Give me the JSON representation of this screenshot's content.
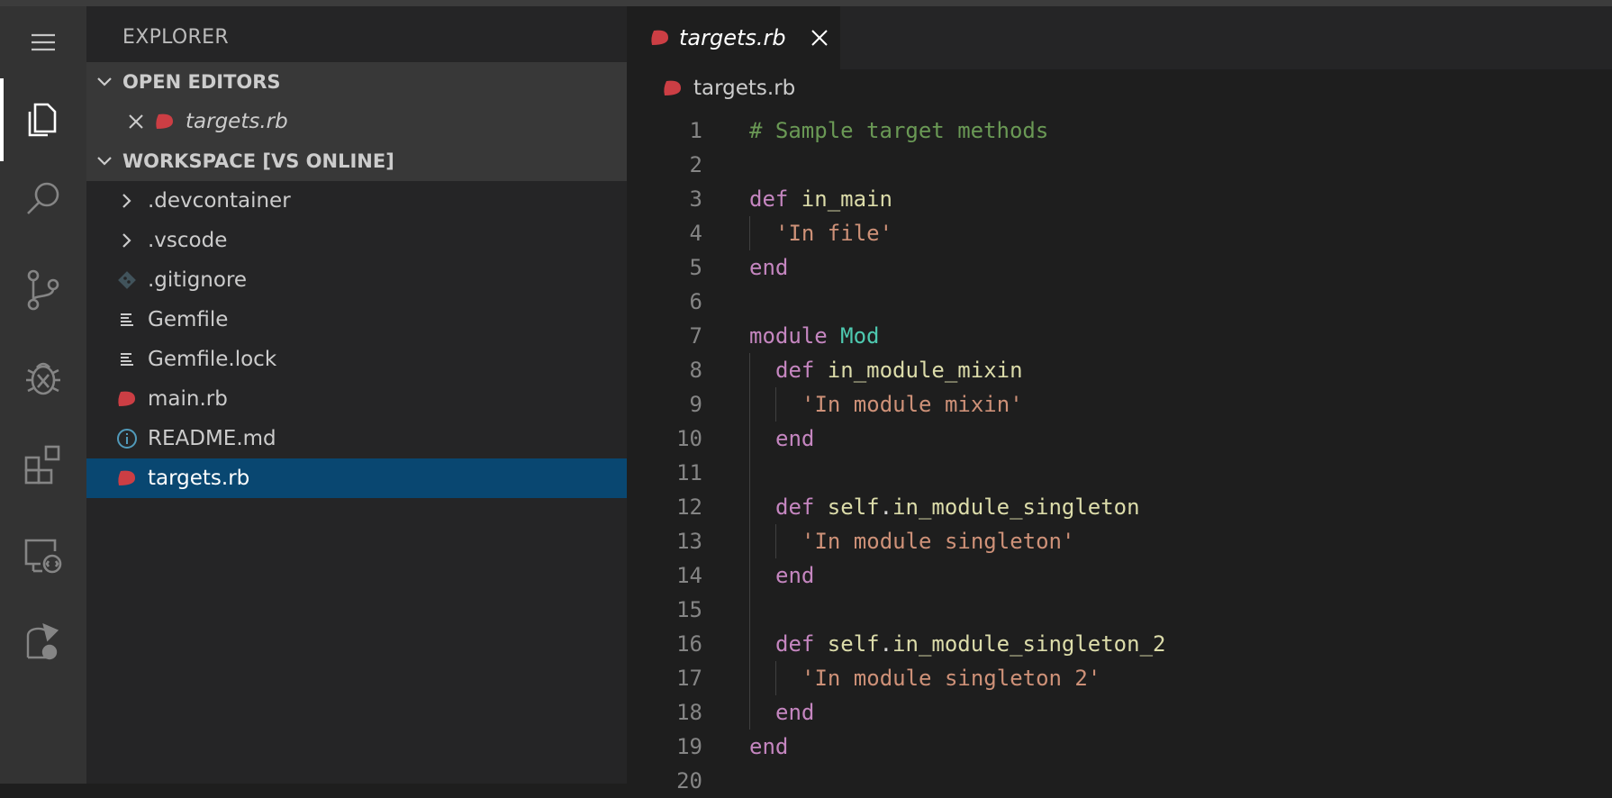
{
  "sidebar": {
    "title": "EXPLORER",
    "open_editors": {
      "label": "OPEN EDITORS",
      "file": "targets.rb"
    },
    "workspace": {
      "label": "WORKSPACE [VS ONLINE]",
      "items": [
        {
          "label": ".devcontainer",
          "type": "folder"
        },
        {
          "label": ".vscode",
          "type": "folder"
        },
        {
          "label": ".gitignore",
          "type": "git"
        },
        {
          "label": "Gemfile",
          "type": "text"
        },
        {
          "label": "Gemfile.lock",
          "type": "text"
        },
        {
          "label": "main.rb",
          "type": "ruby"
        },
        {
          "label": "README.md",
          "type": "info"
        },
        {
          "label": "targets.rb",
          "type": "ruby",
          "selected": true
        }
      ]
    }
  },
  "editor": {
    "tab": {
      "label": "targets.rb"
    },
    "breadcrumb": "targets.rb",
    "lines": [
      {
        "n": "1",
        "indent": 0,
        "tokens": [
          {
            "t": "# Sample target methods",
            "c": "cm"
          }
        ]
      },
      {
        "n": "2",
        "indent": 0,
        "tokens": []
      },
      {
        "n": "3",
        "indent": 0,
        "tokens": [
          {
            "t": "def ",
            "c": "kw"
          },
          {
            "t": "in_main",
            "c": "fn"
          }
        ]
      },
      {
        "n": "4",
        "indent": 1,
        "tokens": [
          {
            "t": "'In file'",
            "c": "str"
          }
        ]
      },
      {
        "n": "5",
        "indent": 0,
        "tokens": [
          {
            "t": "end",
            "c": "kw"
          }
        ]
      },
      {
        "n": "6",
        "indent": 0,
        "tokens": []
      },
      {
        "n": "7",
        "indent": 0,
        "tokens": [
          {
            "t": "module ",
            "c": "kw"
          },
          {
            "t": "Mod",
            "c": "cls"
          }
        ]
      },
      {
        "n": "8",
        "indent": 1,
        "tokens": [
          {
            "t": "def ",
            "c": "kw"
          },
          {
            "t": "in_module_mixin",
            "c": "fn"
          }
        ]
      },
      {
        "n": "9",
        "indent": 2,
        "tokens": [
          {
            "t": "'In module mixin'",
            "c": "str"
          }
        ]
      },
      {
        "n": "10",
        "indent": 1,
        "tokens": [
          {
            "t": "end",
            "c": "kw"
          }
        ]
      },
      {
        "n": "11",
        "indent": 1,
        "tokens": []
      },
      {
        "n": "12",
        "indent": 1,
        "tokens": [
          {
            "t": "def ",
            "c": "kw"
          },
          {
            "t": "self",
            "c": "fn"
          },
          {
            "t": ".",
            "c": "plain"
          },
          {
            "t": "in_module_singleton",
            "c": "fn"
          }
        ]
      },
      {
        "n": "13",
        "indent": 2,
        "tokens": [
          {
            "t": "'In module singleton'",
            "c": "str"
          }
        ]
      },
      {
        "n": "14",
        "indent": 1,
        "tokens": [
          {
            "t": "end",
            "c": "kw"
          }
        ]
      },
      {
        "n": "15",
        "indent": 1,
        "tokens": []
      },
      {
        "n": "16",
        "indent": 1,
        "tokens": [
          {
            "t": "def ",
            "c": "kw"
          },
          {
            "t": "self",
            "c": "fn"
          },
          {
            "t": ".",
            "c": "plain"
          },
          {
            "t": "in_module_singleton_2",
            "c": "fn"
          }
        ]
      },
      {
        "n": "17",
        "indent": 2,
        "tokens": [
          {
            "t": "'In module singleton 2'",
            "c": "str"
          }
        ]
      },
      {
        "n": "18",
        "indent": 1,
        "tokens": [
          {
            "t": "end",
            "c": "kw"
          }
        ]
      },
      {
        "n": "19",
        "indent": 0,
        "tokens": [
          {
            "t": "end",
            "c": "kw"
          }
        ]
      },
      {
        "n": "20",
        "indent": 0,
        "tokens": []
      }
    ]
  },
  "colors": {
    "keyword": "#c586c0",
    "function": "#dcdcaa",
    "string": "#ce9178",
    "comment": "#6a9955",
    "class": "#4ec9b0",
    "ruby_icon": "#cc3e44",
    "selection": "#094771"
  },
  "icons": {
    "activity": [
      "menu-icon",
      "explorer-icon",
      "search-icon",
      "source-control-icon",
      "debug-icon",
      "extensions-icon",
      "remote-explorer-icon",
      "live-share-icon"
    ]
  }
}
